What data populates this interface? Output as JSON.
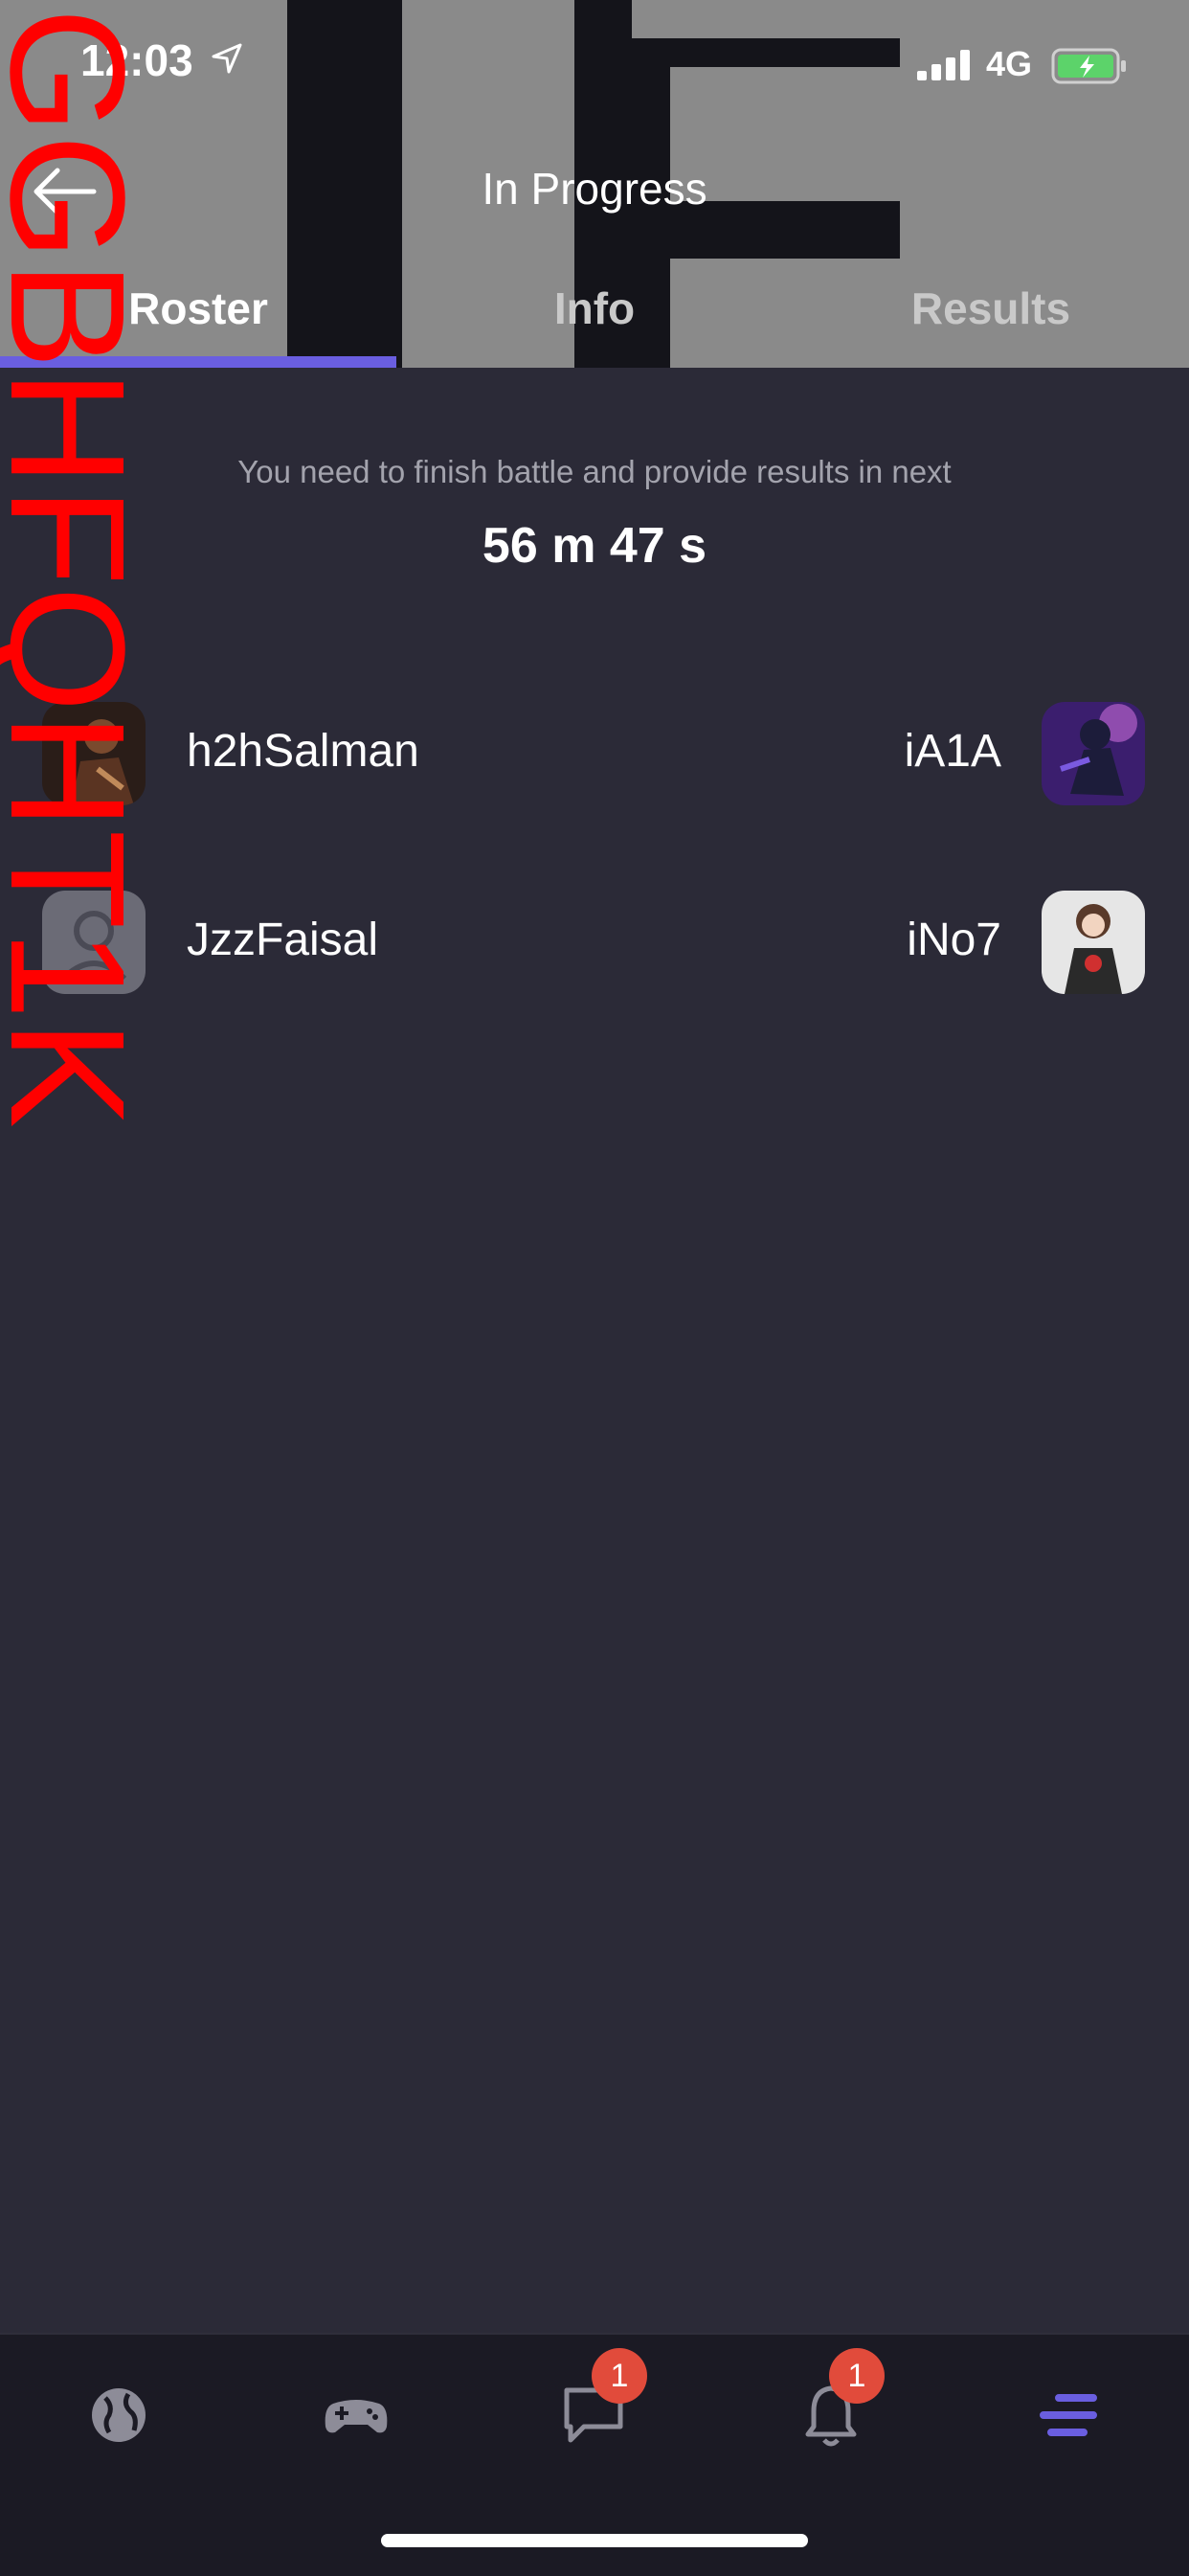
{
  "status_bar": {
    "time": "12:03",
    "network": "4G"
  },
  "header": {
    "title": "In Progress",
    "tabs": [
      {
        "label": "Roster",
        "active": true
      },
      {
        "label": "Info",
        "active": false
      },
      {
        "label": "Results",
        "active": false
      }
    ]
  },
  "roster": {
    "notice": "You need to finish battle and provide results in next",
    "timer": "56 m 47 s",
    "matchups": [
      {
        "left_player": "h2hSalman",
        "right_player": "iA1A"
      },
      {
        "left_player": "JzzFaisal",
        "right_player": "iNo7"
      }
    ]
  },
  "watermark": {
    "text": "GGBHFQHT1K",
    "color": "#ff0000"
  },
  "bottom_nav": {
    "items": [
      {
        "icon": "globe-icon",
        "badge": ""
      },
      {
        "icon": "gamepad-icon",
        "badge": ""
      },
      {
        "icon": "chat-icon",
        "badge": "1"
      },
      {
        "icon": "bell-icon",
        "badge": "1"
      },
      {
        "icon": "menu-icon",
        "badge": ""
      }
    ],
    "accent_color": "#6a5ee0",
    "badge_color": "#e14b3b"
  }
}
